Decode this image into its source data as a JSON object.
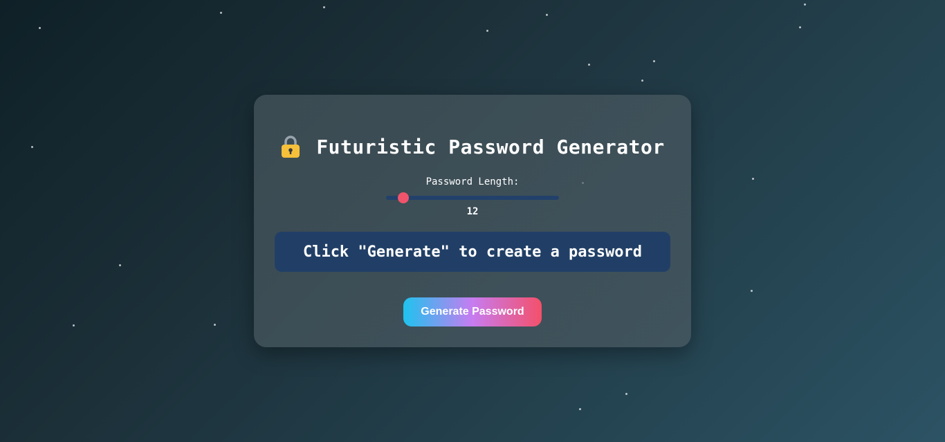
{
  "app": {
    "title": "Futuristic Password Generator",
    "length_label": "Password Length:",
    "length_value": "12",
    "length_fraction": 0.1,
    "output_text": "Click \"Generate\" to create a password",
    "generate_label": "Generate Password"
  },
  "icons": {
    "title": "lock-icon"
  },
  "colors": {
    "slider_track": "#22416a",
    "slider_thumb": "#f0546b",
    "output_bg": "#213f66",
    "button_gradient": [
      "#1ec3ee",
      "#c77cf0",
      "#f4506a"
    ]
  }
}
